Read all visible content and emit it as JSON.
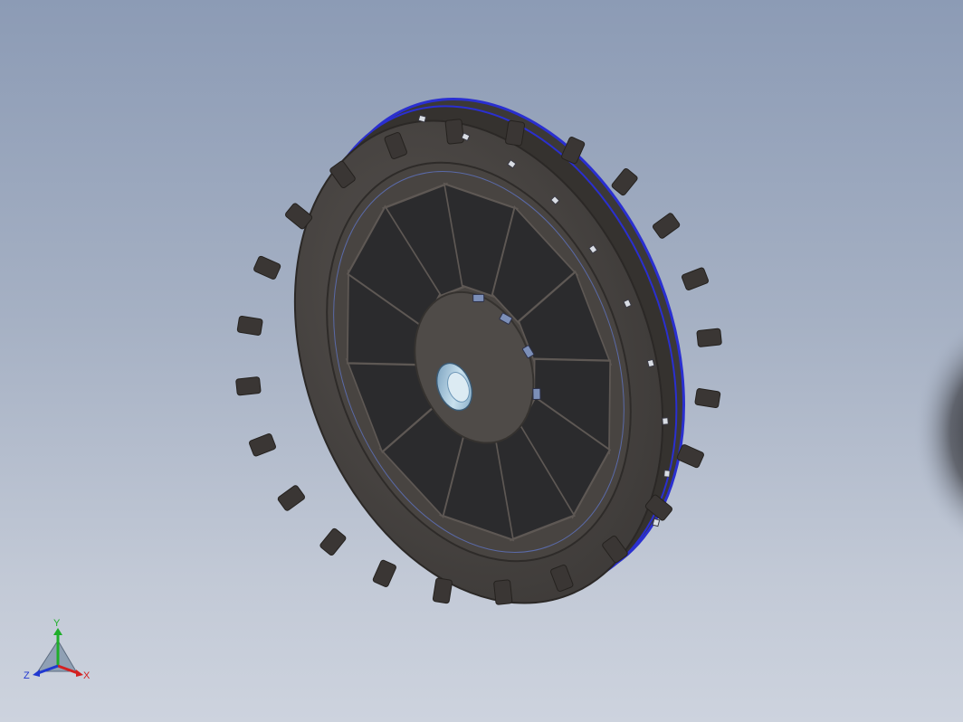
{
  "viewport": {
    "background_top": "#8c9bb5",
    "background_bottom": "#cdd3de"
  },
  "model": {
    "body_color": "#4a4644",
    "window_color": "#2b2b2d",
    "rim_edge_color": "#2a2fd0",
    "bore_color": "#9ec3dc",
    "spoke_count": 12,
    "rim_pocket_count": 24
  },
  "triad": {
    "y_label": "Y",
    "x_label": "X",
    "z_label": "Z",
    "y_color": "#1fae2a",
    "x_color": "#d42020",
    "z_color": "#2038d0"
  }
}
